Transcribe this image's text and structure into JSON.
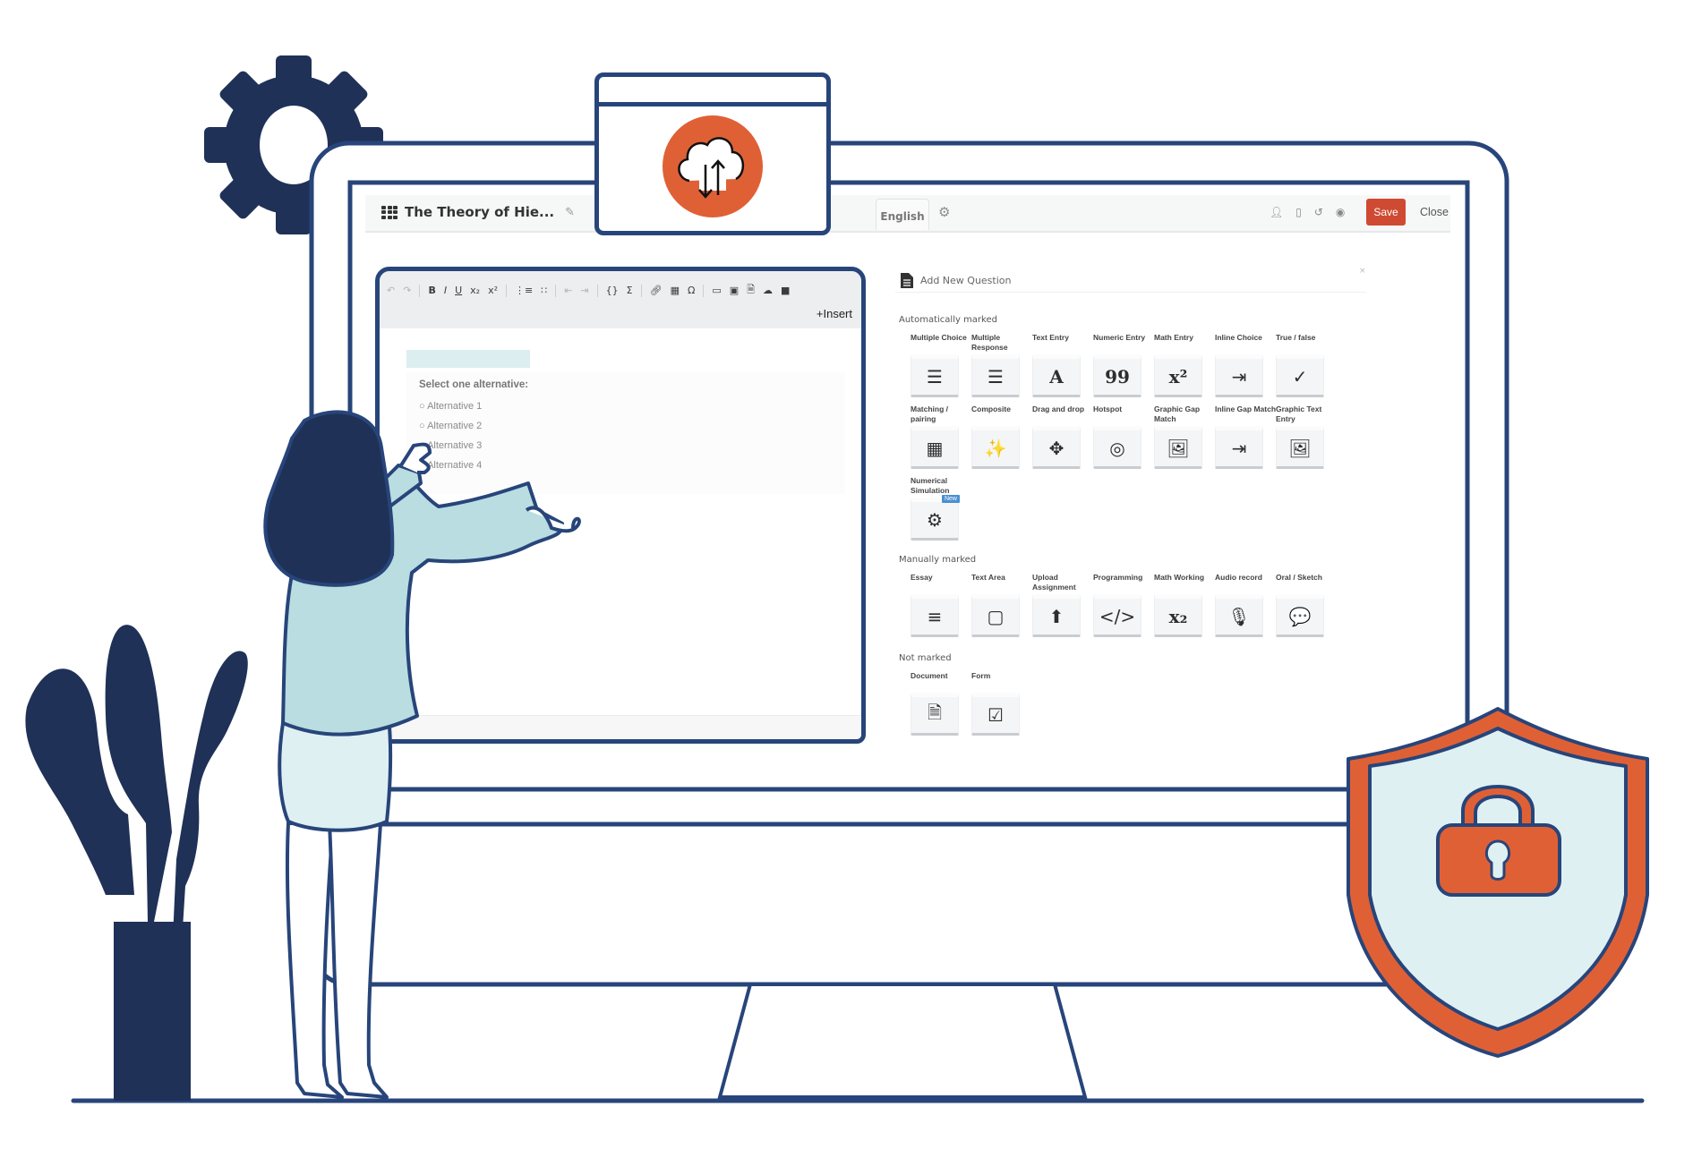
{
  "header": {
    "title": "The Theory of Hie...",
    "language_tab": "English",
    "save_label": "Save",
    "close_label": "Close",
    "icons": [
      "user-icon",
      "mobile-icon",
      "history-icon",
      "preview-eye-icon"
    ]
  },
  "editor": {
    "toolbar": [
      "undo",
      "redo",
      "bold",
      "italic",
      "underline",
      "subscript",
      "superscript",
      "ordered-list",
      "unordered-list",
      "outdent",
      "indent",
      "code",
      "sigma",
      "link",
      "table",
      "omega",
      "media-link",
      "image",
      "pdf",
      "cloud",
      "video"
    ],
    "insert_label": "+Insert",
    "question_prompt": "Select one alternative:",
    "alternatives": [
      "Alternative 1",
      "Alternative 2",
      "Alternative 3",
      "Alternative 4"
    ]
  },
  "add_question": {
    "title": "Add New Question",
    "close_glyph": "×",
    "sections": [
      {
        "name": "Automatically marked",
        "items": [
          {
            "label": "Multiple Choice",
            "icon": "list-bullets-icon",
            "glyph": "☰"
          },
          {
            "label": "Multiple Response",
            "icon": "list-icon",
            "glyph": "☰"
          },
          {
            "label": "Text Entry",
            "icon": "letter-a-icon",
            "glyph": "A"
          },
          {
            "label": "Numeric Entry",
            "icon": "numeric-99-icon",
            "glyph": "99"
          },
          {
            "label": "Math Entry",
            "icon": "superscript-icon",
            "glyph": "x²"
          },
          {
            "label": "Inline Choice",
            "icon": "indent-list-icon",
            "glyph": "⇥"
          },
          {
            "label": "True / false",
            "icon": "check-circle-icon",
            "glyph": "✓"
          },
          {
            "label": "Matching / pairing",
            "icon": "grid-icon",
            "glyph": "▦"
          },
          {
            "label": "Composite",
            "icon": "magic-wand-icon",
            "glyph": "✨"
          },
          {
            "label": "Drag and drop",
            "icon": "move-arrows-icon",
            "glyph": "✥"
          },
          {
            "label": "Hotspot",
            "icon": "target-icon",
            "glyph": "◎"
          },
          {
            "label": "Graphic Gap Match",
            "icon": "picture-icon",
            "glyph": "🖼"
          },
          {
            "label": "Inline Gap Match",
            "icon": "indent-list-icon",
            "glyph": "⇥"
          },
          {
            "label": "Graphic Text Entry",
            "icon": "picture-icon",
            "glyph": "🖼"
          },
          {
            "label": "Numerical Simulation",
            "icon": "gears-icon",
            "glyph": "⚙",
            "badge": "New"
          }
        ]
      },
      {
        "name": "Manually marked",
        "items": [
          {
            "label": "Essay",
            "icon": "text-lines-icon",
            "glyph": "≡"
          },
          {
            "label": "Text Area",
            "icon": "square-icon",
            "glyph": "▢"
          },
          {
            "label": "Upload Assignment",
            "icon": "upload-icon",
            "glyph": "⬆"
          },
          {
            "label": "Programming",
            "icon": "code-icon",
            "glyph": "</>"
          },
          {
            "label": "Math Working",
            "icon": "subscript-icon",
            "glyph": "x₂"
          },
          {
            "label": "Audio record",
            "icon": "microphone-icon",
            "glyph": "🎙"
          },
          {
            "label": "Oral / Sketch",
            "icon": "speech-bubble-icon",
            "glyph": "💬"
          }
        ]
      },
      {
        "name": "Not marked",
        "items": [
          {
            "label": "Document",
            "icon": "document-icon",
            "glyph": "🗎"
          },
          {
            "label": "Form",
            "icon": "checkbox-icon",
            "glyph": "☑"
          }
        ]
      }
    ]
  },
  "colors": {
    "navy": "#27457a",
    "navy_dark": "#1f3157",
    "orange": "#e06036",
    "save_red": "#cf4a32",
    "light_teal": "#b9dde0",
    "pale_blue": "#dff0f3",
    "new_badge": "#4b8fd1"
  }
}
